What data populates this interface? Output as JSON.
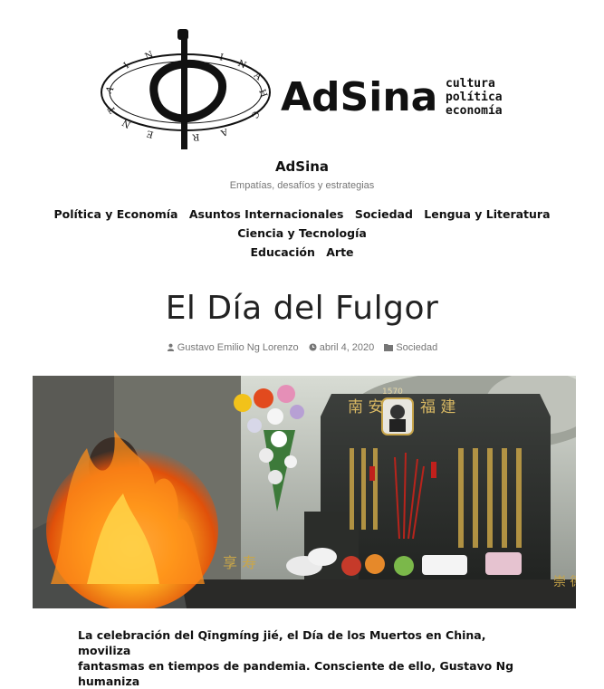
{
  "logo": {
    "wordmark": "AdSina",
    "taglines": [
      "cultura",
      "política",
      "economía"
    ],
    "ring_text": "CHINA · ARGENTINA",
    "center_glyph": "中"
  },
  "site": {
    "title": "AdSina",
    "tagline": "Empatías, desafíos y estrategias"
  },
  "nav": {
    "items": [
      "Política y Economía",
      "Asuntos Internacionales",
      "Sociedad",
      "Lengua y Literatura",
      "Ciencia y Tecnología",
      "Educación",
      "Arte"
    ]
  },
  "post": {
    "title": "El Día del Fulgor",
    "author": "Gustavo Emilio Ng Lorenzo",
    "date": "abril 4, 2020",
    "category": "Sociedad",
    "image_text": {
      "year": "1570",
      "left_glyphs": "南 安",
      "right_glyphs": "福 建",
      "base_left": "享 寿",
      "base_right": "崇 德"
    },
    "excerpt_line1": "La celebración del Qīngmíng jié, el Día de los Muertos en China, moviliza",
    "excerpt_line2": "fantasmas en tiempos de pandemia. Consciente de ello, Gustavo Ng humaniza"
  },
  "colors": {
    "meta_gray": "#767676",
    "text_dark": "#111111"
  }
}
